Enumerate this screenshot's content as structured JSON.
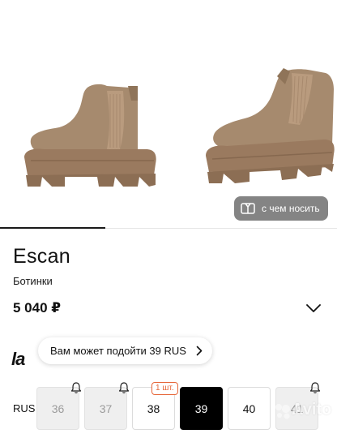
{
  "gallery": {
    "outfit_button_label": "с чем носить",
    "images": [
      "boot-side-view",
      "boot-three-quarter-view"
    ]
  },
  "product": {
    "brand": "Escan",
    "category": "Ботинки",
    "price": "5 040 ₽"
  },
  "logo": {
    "text": "la"
  },
  "size_suggestion": {
    "text": "Вам может подойти 39 RUS"
  },
  "sizes": {
    "system_label": "RUS",
    "stock_badge": "1 шт.",
    "items": [
      {
        "label": "36",
        "state": "unavailable",
        "notify_bell": true
      },
      {
        "label": "37",
        "state": "unavailable",
        "notify_bell": true
      },
      {
        "label": "38",
        "state": "available",
        "notify_bell": false
      },
      {
        "label": "39",
        "state": "selected",
        "notify_bell": false
      },
      {
        "label": "40",
        "state": "available",
        "notify_bell": false
      },
      {
        "label": "41",
        "state": "unavailable",
        "notify_bell": true
      }
    ]
  },
  "watermark": {
    "text": "Avito"
  },
  "colors": {
    "suede": "#a68a6e",
    "sole": "#9a7a5f",
    "elastic": "#b99b7e",
    "badge": "#e6673a",
    "selected": "#000000"
  }
}
